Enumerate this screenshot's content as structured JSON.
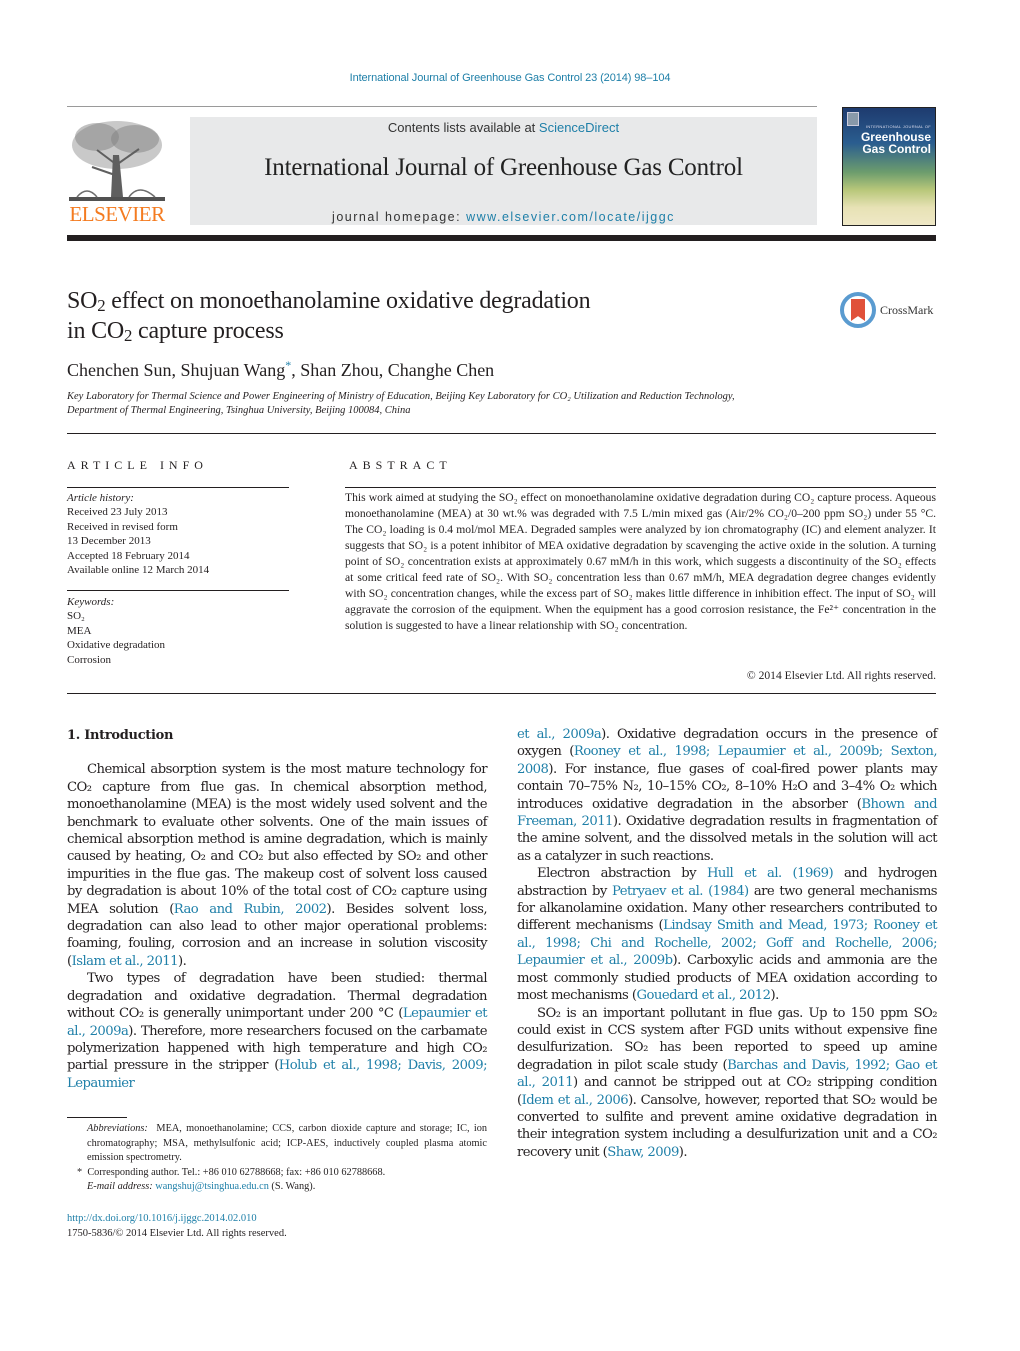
{
  "header": {
    "journal_ref": "International Journal of Greenhouse Gas Control 23 (2014) 98–104",
    "contents_prefix": "Contents lists available at ",
    "contents_link": "ScienceDirect",
    "journal_title": "International Journal of Greenhouse Gas Control",
    "homepage_prefix": "journal homepage: ",
    "homepage_link": "www.elsevier.com/locate/ijggc",
    "publisher_logo_text": "ELSEVIER",
    "cover": {
      "small_text": "INTERNATIONAL JOURNAL OF",
      "title_line1": "Greenhouse",
      "title_line2": "Gas Control"
    },
    "crossmark_label": "CrossMark"
  },
  "article": {
    "title_line1_pre": "SO",
    "title_line1_sub": "2",
    "title_line1_post": " effect on monoethanolamine oxidative degradation",
    "title_line2_pre": "in CO",
    "title_line2_sub": "2",
    "title_line2_post": " capture process",
    "authors": [
      {
        "name": "Chenchen Sun",
        "corresponding": false
      },
      {
        "name": "Shujuan Wang",
        "corresponding": true
      },
      {
        "name": "Shan Zhou",
        "corresponding": false
      },
      {
        "name": "Changhe Chen",
        "corresponding": false
      }
    ],
    "affiliation_line1": "Key Laboratory for Thermal Science and Power Engineering of Ministry of Education, Beijing Key Laboratory for CO₂ Utilization and Reduction Technology,",
    "affiliation_line2": "Department of Thermal Engineering, Tsinghua University, Beijing 100084, China"
  },
  "article_info": {
    "heading": "ARTICLE INFO",
    "history_label": "Article history:",
    "history": [
      "Received 23 July 2013",
      "Received in revised form",
      "13 December 2013",
      "Accepted 18 February 2014",
      "Available online 12 March 2014"
    ],
    "keywords_label": "Keywords:",
    "keywords": [
      "SO₂",
      "MEA",
      "Oxidative degradation",
      "Corrosion"
    ]
  },
  "abstract": {
    "heading": "ABSTRACT",
    "text": "This work aimed at studying the SO₂ effect on monoethanolamine oxidative degradation during CO₂ capture process. Aqueous monoethanolamine (MEA) at 30 wt.% was degraded with 7.5 L/min mixed gas (Air/2% CO₂/0–200 ppm SO₂) under 55 °C. The CO₂ loading is 0.4 mol/mol MEA. Degraded samples were analyzed by ion chromatography (IC) and element analyzer. It suggests that SO₂ is a potent inhibitor of MEA oxidative degradation by scavenging the active oxide in the solution. A turning point of SO₂ concentration exists at approximately 0.67 mM/h in this work, which suggests a discontinuity of the SO₂ effects at some critical feed rate of SO₂. With SO₂ concentration less than 0.67 mM/h, MEA degradation degree changes evidently with SO₂ concentration changes, while the excess part of SO₂ makes little difference in inhibition effect. The input of SO₂ will aggravate the corrosion of the equipment. When the equipment has a good corrosion resistance, the Fe²⁺ concentration in the solution is suggested to have a linear relationship with SO₂ concentration.",
    "copyright": "© 2014 Elsevier Ltd. All rights reserved."
  },
  "body": {
    "section_heading": "1.  Introduction",
    "left_paragraphs": [
      [
        {
          "t": "Chemical absorption system is the most mature technology for CO₂ capture from flue gas. In chemical absorption method, monoethanolamine (MEA) is the most widely used solvent and the benchmark to evaluate other solvents. One of the main issues of chemical absorption method is amine degradation, which is mainly caused by heating, O₂ and CO₂ but also effected by SO₂ and other impurities in the flue gas. The makeup cost of solvent loss caused by degradation is about 10% of the total cost of CO₂ capture using MEA solution ("
        },
        {
          "t": "Rao and Rubin, 2002",
          "link": true
        },
        {
          "t": "). Besides solvent loss, degradation can also lead to other major operational problems: foaming, fouling, corrosion and an increase in solution viscosity ("
        },
        {
          "t": "Islam et al., 2011",
          "link": true
        },
        {
          "t": ")."
        }
      ],
      [
        {
          "t": "Two types of degradation have been studied: thermal degradation and oxidative degradation. Thermal degradation without CO₂ is generally unimportant under 200 °C ("
        },
        {
          "t": "Lepaumier et al., 2009a",
          "link": true
        },
        {
          "t": "). Therefore, more researchers focused on the carbamate polymerization happened with high temperature and high CO₂ partial pressure in the stripper ("
        },
        {
          "t": "Holub et al., 1998; Davis, 2009; Lepaumier",
          "link": true
        }
      ]
    ],
    "right_paragraphs": [
      [
        {
          "t": "et al., 2009a",
          "link": true
        },
        {
          "t": "). Oxidative degradation occurs in the presence of oxygen ("
        },
        {
          "t": "Rooney et al., 1998; Lepaumier et al., 2009b; Sexton, 2008",
          "link": true
        },
        {
          "t": "). For instance, flue gases of coal-fired power plants may contain 70–75% N₂, 10–15% CO₂, 8–10% H₂O and 3–4% O₂ which introduces oxidative degradation in the absorber ("
        },
        {
          "t": "Bhown and Freeman, 2011",
          "link": true
        },
        {
          "t": "). Oxidative degradation results in fragmentation of the amine solvent, and the dissolved metals in the solution will act as a catalyzer in such reactions."
        }
      ],
      [
        {
          "t": "Electron abstraction by "
        },
        {
          "t": "Hull et al. (1969)",
          "link": true
        },
        {
          "t": " and hydrogen abstraction by "
        },
        {
          "t": "Petryaev et al. (1984)",
          "link": true
        },
        {
          "t": " are two general mechanisms for alkanolamine oxidation. Many other researchers contributed to different mechanisms ("
        },
        {
          "t": "Lindsay Smith and Mead, 1973; Rooney et al., 1998; Chi and Rochelle, 2002; Goff and Rochelle, 2006; Lepaumier et al., 2009b",
          "link": true
        },
        {
          "t": "). Carboxylic acids and ammonia are the most commonly studied products of MEA oxidation according to most mechanisms ("
        },
        {
          "t": "Gouedard et al., 2012",
          "link": true
        },
        {
          "t": ")."
        }
      ],
      [
        {
          "t": "SO₂ is an important pollutant in flue gas. Up to 150 ppm SO₂ could exist in CCS system after FGD units without expensive fine desulfurization. SO₂ has been reported to speed up amine degradation in pilot scale study ("
        },
        {
          "t": "Barchas and Davis, 1992; Gao et al., 2011",
          "link": true
        },
        {
          "t": ") and cannot be stripped out at CO₂ stripping condition ("
        },
        {
          "t": "Idem et al., 2006",
          "link": true
        },
        {
          "t": "). Cansolve, however, reported that SO₂ would be converted to sulfite and prevent amine oxidative degradation in their integration system including a desulfurization unit and a CO₂ recovery unit ("
        },
        {
          "t": "Shaw, 2009",
          "link": true
        },
        {
          "t": ")."
        }
      ]
    ]
  },
  "footnotes": {
    "abbrev_label": "Abbreviations:",
    "abbrev_text": "MEA, monoethanolamine; CCS, carbon dioxide capture and storage; IC, ion chromatography; MSA, methylsulfonic acid; ICP-AES, inductively coupled plasma atomic emission spectrometry.",
    "corresponding_mark": "*",
    "corresponding_text": "Corresponding author. Tel.: +86 010 62788668; fax: +86 010 62788668.",
    "email_label": "E-mail address:",
    "email": "wangshuj@tsinghua.edu.cn",
    "email_suffix": " (S. Wang).",
    "doi": "http://dx.doi.org/10.1016/j.ijggc.2014.02.010",
    "issn_line": "1750-5836/© 2014 Elsevier Ltd. All rights reserved."
  },
  "colors": {
    "link": "#1e7fa8",
    "elsevier_orange": "#f47b20",
    "masthead_bg": "#e8e9ea",
    "text": "#231f20"
  }
}
